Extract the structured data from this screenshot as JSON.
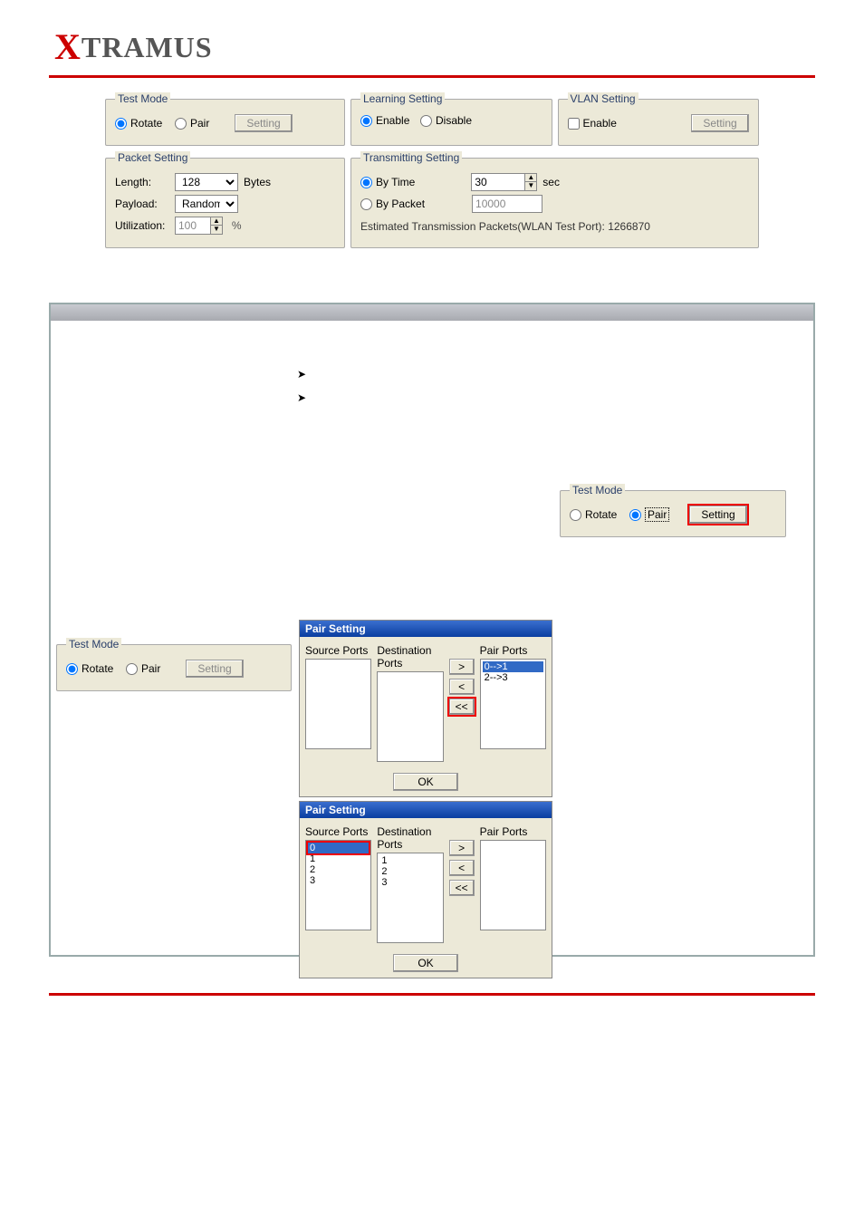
{
  "brand": {
    "x": "X",
    "rest": "TRAMUS"
  },
  "top": {
    "testMode": {
      "legend": "Test Mode",
      "rotate": "Rotate",
      "pair": "Pair",
      "setting": "Setting",
      "selected": "rotate"
    },
    "learning": {
      "legend": "Learning Setting",
      "enable": "Enable",
      "disable": "Disable",
      "selected": "enable"
    },
    "vlan": {
      "legend": "VLAN Setting",
      "enable": "Enable",
      "setting": "Setting",
      "checked": false
    },
    "packet": {
      "legend": "Packet Setting",
      "length": "Length:",
      "lengthValue": "128",
      "lengthUnit": "Bytes",
      "payload": "Payload:",
      "payloadValue": "Random",
      "utilization": "Utilization:",
      "utilizationValue": "100",
      "utilUnit": "%"
    },
    "transmit": {
      "legend": "Transmitting Setting",
      "byTime": "By Time",
      "byTimeValue": "30",
      "byTimeUnit": "sec",
      "byPacket": "By Packet",
      "byPacketValue": "10000",
      "estimated": "Estimated Transmission Packets(WLAN Test Port): 1266870",
      "selected": "time"
    }
  },
  "panel": {
    "tmBR": {
      "legend": "Test Mode",
      "rotate": "Rotate",
      "pair": "Pair",
      "setting": "Setting",
      "selected": "pair"
    },
    "tmBL": {
      "legend": "Test Mode",
      "rotate": "Rotate",
      "pair": "Pair",
      "setting": "Setting",
      "selected": "rotate"
    },
    "pair1": {
      "title": "Pair Setting",
      "src": "Source Ports",
      "dst": "Destination Ports",
      "pairs": "Pair Ports",
      "pairItems": [
        "0-->1",
        "2-->3"
      ],
      "gt": ">",
      "lt": "<",
      "ltlt": "<<",
      "ok": "OK"
    },
    "pair2": {
      "title": "Pair Setting",
      "src": "Source Ports",
      "dst": "Destination Ports",
      "pairs": "Pair Ports",
      "srcItems": [
        "0",
        "1",
        "2",
        "3"
      ],
      "dstItems": [
        "1",
        "2",
        "3"
      ],
      "gt": ">",
      "lt": "<",
      "ltlt": "<<",
      "ok": "OK"
    }
  }
}
